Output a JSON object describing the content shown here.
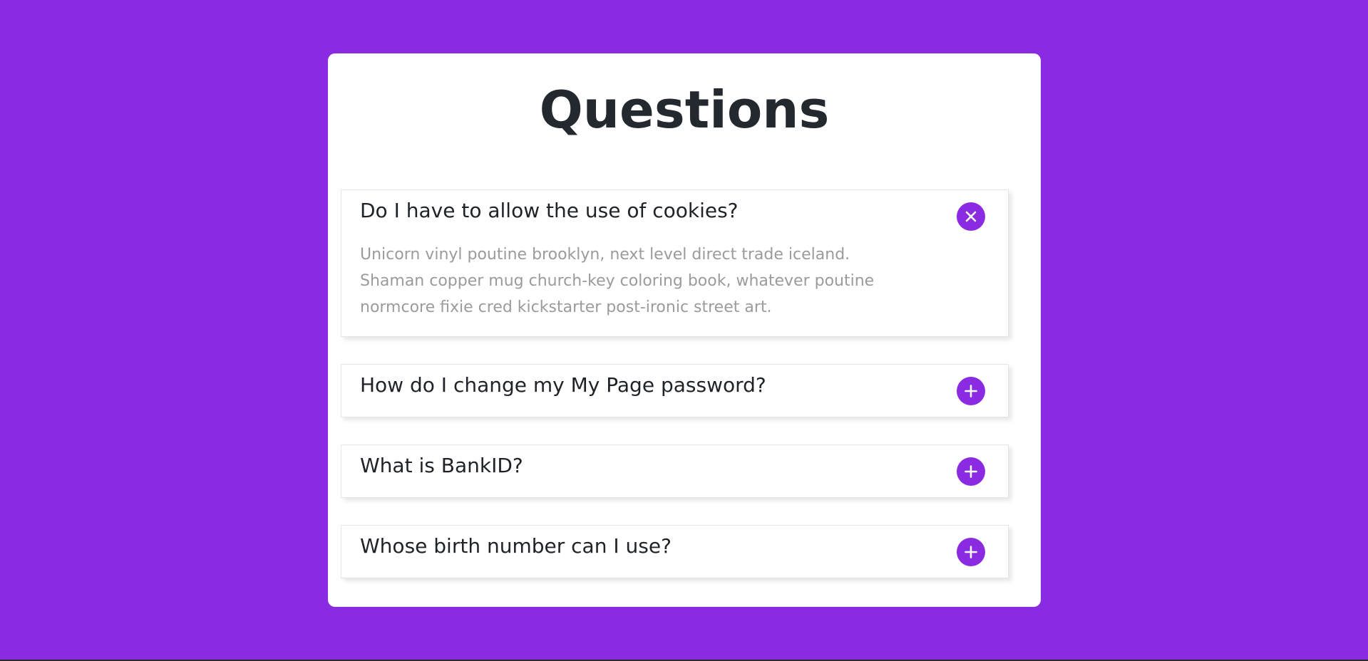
{
  "page": {
    "title": "Questions"
  },
  "colors": {
    "background": "#8a2be2",
    "accent": "#8a2be2",
    "card": "#ffffff",
    "question_text": "#1f2328",
    "answer_text": "#9b9b9b"
  },
  "faq": {
    "items": [
      {
        "question": "Do I have to allow the use of cookies?",
        "answer": "Unicorn vinyl poutine brooklyn, next level direct trade iceland. Shaman copper mug church-key coloring book, whatever poutine normcore fixie cred kickstarter post-ironic street art.",
        "expanded": true,
        "icon": "close-icon"
      },
      {
        "question": "How do I change my My Page password?",
        "expanded": false,
        "icon": "plus-icon"
      },
      {
        "question": "What is BankID?",
        "expanded": false,
        "icon": "plus-icon"
      },
      {
        "question": "Whose birth number can I use?",
        "expanded": false,
        "icon": "plus-icon"
      }
    ]
  }
}
